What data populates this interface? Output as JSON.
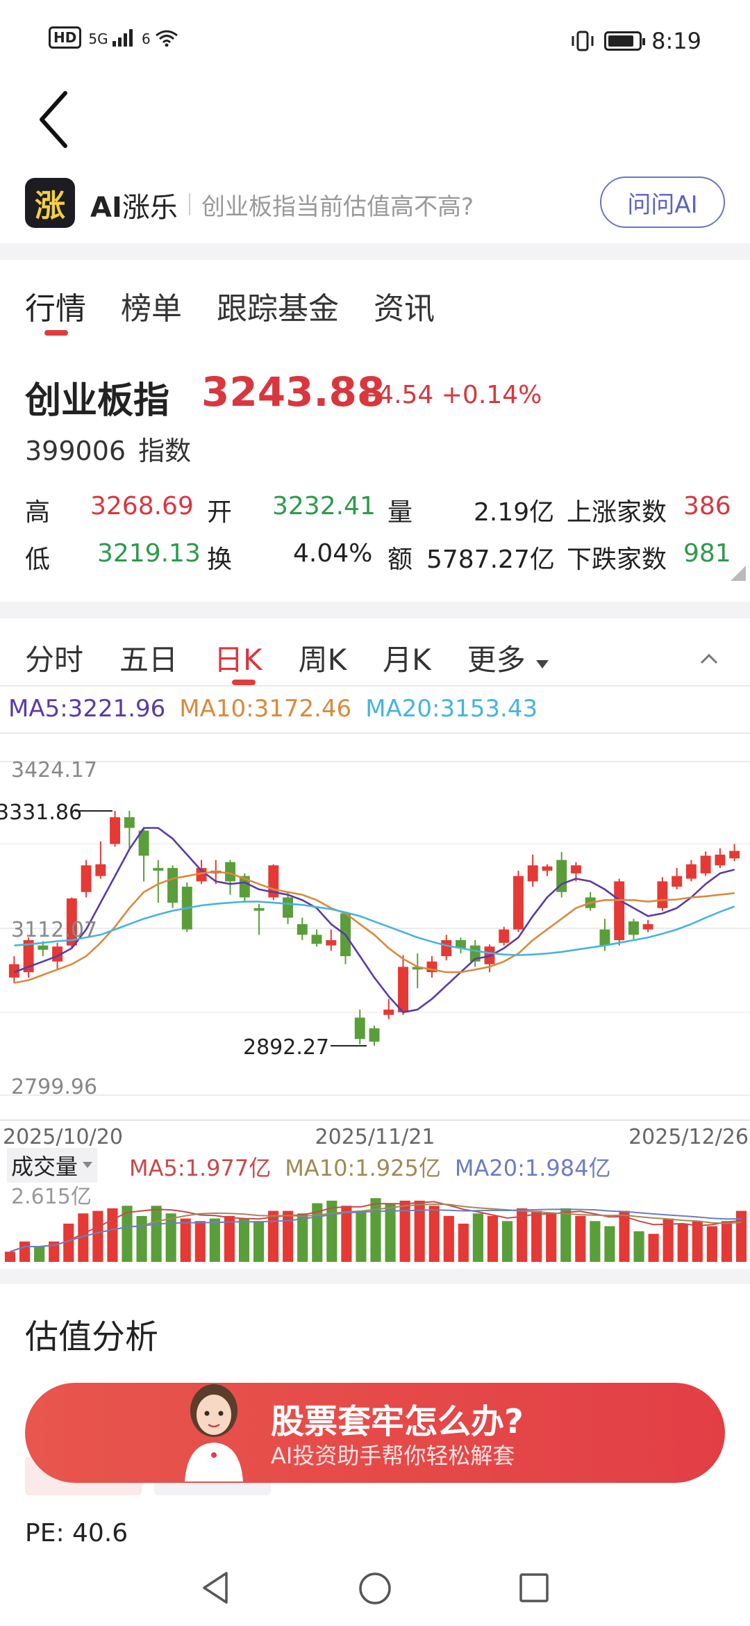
{
  "status_bar": {
    "hd": "HD",
    "signal": "5G",
    "wifi": "6",
    "time": "8:19"
  },
  "ai_bar": {
    "logo_char": "涨",
    "name_ai": "AI",
    "name_rest": "涨乐",
    "placeholder": "创业板指当前估值高不高?",
    "ask_button": "问问AI"
  },
  "main_tabs": [
    "行情",
    "榜单",
    "跟踪基金",
    "资讯"
  ],
  "index": {
    "name": "创业板指",
    "price": "3243.88",
    "change": "+4.54 +0.14%",
    "code": "399006",
    "type": "指数"
  },
  "stats": {
    "high_label": "高",
    "high": "3268.69",
    "open_label": "开",
    "open": "3232.41",
    "volume_label": "量",
    "volume": "2.19亿",
    "up_label": "上涨家数",
    "up": "386",
    "low_label": "低",
    "low": "3219.13",
    "turnover_label": "换",
    "turnover": "4.04%",
    "amount_label": "额",
    "amount": "5787.27亿",
    "down_label": "下跌家数",
    "down": "981"
  },
  "period_tabs": [
    "分时",
    "五日",
    "日K",
    "周K",
    "月K",
    "更多"
  ],
  "ma": {
    "ma5": "MA5:3221.96",
    "ma10": "MA10:3172.46",
    "ma20": "MA20:3153.43"
  },
  "chart_data": {
    "type": "candlestick",
    "y_ticks": [
      "3424.17",
      "3112.07",
      "2799.96"
    ],
    "ylim": [
      2799.96,
      3424.17
    ],
    "annotations": [
      {
        "label": "3331.86",
        "value": 3331.86
      },
      {
        "label": "2892.27",
        "value": 2892.27
      }
    ],
    "x_ticks": [
      "2025/10/20",
      "2025/11/21",
      "2025/12/26"
    ],
    "candles": [
      {
        "o": 3020,
        "c": 3045,
        "h": 3060,
        "l": 3010
      },
      {
        "o": 3030,
        "c": 3090,
        "h": 3095,
        "l": 3020
      },
      {
        "o": 3080,
        "c": 3072,
        "h": 3088,
        "l": 3060
      },
      {
        "o": 3050,
        "c": 3078,
        "h": 3085,
        "l": 3035
      },
      {
        "o": 3080,
        "c": 3168,
        "h": 3170,
        "l": 3075
      },
      {
        "o": 3180,
        "c": 3230,
        "h": 3240,
        "l": 3170
      },
      {
        "o": 3210,
        "c": 3232,
        "h": 3275,
        "l": 3205
      },
      {
        "o": 3270,
        "c": 3320,
        "h": 3332,
        "l": 3265
      },
      {
        "o": 3320,
        "c": 3300,
        "h": 3332,
        "l": 3260
      },
      {
        "o": 3295,
        "c": 3248,
        "h": 3300,
        "l": 3200
      },
      {
        "o": 3225,
        "c": 3220,
        "h": 3240,
        "l": 3160
      },
      {
        "o": 3225,
        "c": 3160,
        "h": 3230,
        "l": 3150
      },
      {
        "o": 3190,
        "c": 3110,
        "h": 3198,
        "l": 3105
      },
      {
        "o": 3200,
        "c": 3225,
        "h": 3240,
        "l": 3195
      },
      {
        "o": 3215,
        "c": 3220,
        "h": 3240,
        "l": 3195
      },
      {
        "o": 3236,
        "c": 3200,
        "h": 3240,
        "l": 3175
      },
      {
        "o": 3210,
        "c": 3170,
        "h": 3215,
        "l": 3160
      },
      {
        "o": 3150,
        "c": 3145,
        "h": 3158,
        "l": 3100
      },
      {
        "o": 3170,
        "c": 3230,
        "h": 3232,
        "l": 3165
      },
      {
        "o": 3170,
        "c": 3132,
        "h": 3180,
        "l": 3120
      },
      {
        "o": 3120,
        "c": 3100,
        "h": 3132,
        "l": 3090
      },
      {
        "o": 3100,
        "c": 3083,
        "h": 3110,
        "l": 3078
      },
      {
        "o": 3080,
        "c": 3090,
        "h": 3110,
        "l": 3070
      },
      {
        "o": 3140,
        "c": 3060,
        "h": 3142,
        "l": 3045
      },
      {
        "o": 2945,
        "c": 2905,
        "h": 2960,
        "l": 2895
      },
      {
        "o": 2925,
        "c": 2900,
        "h": 2930,
        "l": 2892
      },
      {
        "o": 2950,
        "c": 2960,
        "h": 2980,
        "l": 2942
      },
      {
        "o": 2955,
        "c": 3040,
        "h": 3062,
        "l": 2950
      },
      {
        "o": 3040,
        "c": 3035,
        "h": 3065,
        "l": 3000
      },
      {
        "o": 3030,
        "c": 3050,
        "h": 3060,
        "l": 3020
      },
      {
        "o": 3060,
        "c": 3090,
        "h": 3100,
        "l": 3052
      },
      {
        "o": 3090,
        "c": 3075,
        "h": 3095,
        "l": 3065
      },
      {
        "o": 3080,
        "c": 3050,
        "h": 3090,
        "l": 3040
      },
      {
        "o": 3045,
        "c": 3078,
        "h": 3082,
        "l": 3030
      },
      {
        "o": 3085,
        "c": 3110,
        "h": 3115,
        "l": 3080
      },
      {
        "o": 3110,
        "c": 3210,
        "h": 3220,
        "l": 3105
      },
      {
        "o": 3200,
        "c": 3230,
        "h": 3250,
        "l": 3190
      },
      {
        "o": 3220,
        "c": 3228,
        "h": 3232,
        "l": 3210
      },
      {
        "o": 3240,
        "c": 3180,
        "h": 3255,
        "l": 3170
      },
      {
        "o": 3215,
        "c": 3230,
        "h": 3236,
        "l": 3200
      },
      {
        "o": 3170,
        "c": 3150,
        "h": 3180,
        "l": 3145
      },
      {
        "o": 3110,
        "c": 3080,
        "h": 3130,
        "l": 3070
      },
      {
        "o": 3090,
        "c": 3200,
        "h": 3205,
        "l": 3080
      },
      {
        "o": 3125,
        "c": 3100,
        "h": 3130,
        "l": 3092
      },
      {
        "o": 3110,
        "c": 3120,
        "h": 3128,
        "l": 3105
      },
      {
        "o": 3150,
        "c": 3200,
        "h": 3208,
        "l": 3145
      },
      {
        "o": 3190,
        "c": 3210,
        "h": 3225,
        "l": 3185
      },
      {
        "o": 3205,
        "c": 3232,
        "h": 3240,
        "l": 3200
      },
      {
        "o": 3215,
        "c": 3248,
        "h": 3256,
        "l": 3210
      },
      {
        "o": 3230,
        "c": 3250,
        "h": 3262,
        "l": 3225
      },
      {
        "o": 3243,
        "c": 3257,
        "h": 3270,
        "l": 3238
      }
    ],
    "ma_lines": [
      {
        "name": "MA5",
        "color": "#5a3aa8",
        "values": [
          3030,
          3040,
          3050,
          3060,
          3075,
          3110,
          3160,
          3210,
          3260,
          3300,
          3300,
          3280,
          3250,
          3220,
          3200,
          3195,
          3198,
          3185,
          3180,
          3175,
          3165,
          3150,
          3120,
          3100,
          3060,
          3020,
          2985,
          2955,
          2960,
          2980,
          3005,
          3030,
          3055,
          3060,
          3075,
          3095,
          3135,
          3170,
          3195,
          3205,
          3200,
          3185,
          3165,
          3150,
          3135,
          3140,
          3150,
          3170,
          3195,
          3215,
          3222
        ]
      },
      {
        "name": "MA10",
        "color": "#d98a3c",
        "values": [
          3010,
          3015,
          3025,
          3035,
          3045,
          3060,
          3085,
          3115,
          3150,
          3180,
          3195,
          3205,
          3210,
          3215,
          3218,
          3215,
          3205,
          3195,
          3185,
          3180,
          3175,
          3165,
          3150,
          3140,
          3120,
          3100,
          3075,
          3055,
          3040,
          3035,
          3030,
          3030,
          3035,
          3040,
          3050,
          3065,
          3090,
          3110,
          3130,
          3150,
          3160,
          3165,
          3165,
          3165,
          3162,
          3165,
          3166,
          3170,
          3172,
          3175,
          3178
        ]
      },
      {
        "name": "MA20",
        "color": "#46b4dc",
        "values": [
          3080,
          3082,
          3085,
          3088,
          3090,
          3095,
          3100,
          3110,
          3120,
          3130,
          3138,
          3145,
          3150,
          3155,
          3158,
          3160,
          3162,
          3162,
          3160,
          3158,
          3156,
          3152,
          3148,
          3142,
          3135,
          3125,
          3115,
          3105,
          3095,
          3087,
          3080,
          3075,
          3070,
          3066,
          3063,
          3062,
          3063,
          3065,
          3068,
          3072,
          3076,
          3080,
          3085,
          3090,
          3095,
          3102,
          3110,
          3120,
          3132,
          3143,
          3153
        ]
      }
    ]
  },
  "volume": {
    "label": "成交量",
    "ma5": "MA5:1.977亿",
    "ma10": "MA10:1.925亿",
    "ma20": "MA20:1.984亿",
    "max_label": "2.615亿",
    "bars": [
      {
        "v": 0.4,
        "up": true
      },
      {
        "v": 0.8,
        "up": true
      },
      {
        "v": 0.6,
        "up": false
      },
      {
        "v": 0.8,
        "up": true
      },
      {
        "v": 1.5,
        "up": true
      },
      {
        "v": 1.9,
        "up": true
      },
      {
        "v": 2.0,
        "up": true
      },
      {
        "v": 2.1,
        "up": true
      },
      {
        "v": 2.2,
        "up": false
      },
      {
        "v": 1.8,
        "up": false
      },
      {
        "v": 2.2,
        "up": false
      },
      {
        "v": 1.9,
        "up": false
      },
      {
        "v": 1.7,
        "up": true
      },
      {
        "v": 1.6,
        "up": true
      },
      {
        "v": 1.7,
        "up": false
      },
      {
        "v": 1.8,
        "up": true
      },
      {
        "v": 1.7,
        "up": false
      },
      {
        "v": 1.6,
        "up": false
      },
      {
        "v": 2.0,
        "up": true
      },
      {
        "v": 2.0,
        "up": true
      },
      {
        "v": 1.9,
        "up": false
      },
      {
        "v": 2.3,
        "up": false
      },
      {
        "v": 2.4,
        "up": false
      },
      {
        "v": 2.2,
        "up": true
      },
      {
        "v": 2.0,
        "up": false
      },
      {
        "v": 2.5,
        "up": false
      },
      {
        "v": 2.3,
        "up": false
      },
      {
        "v": 2.4,
        "up": true
      },
      {
        "v": 2.4,
        "up": true
      },
      {
        "v": 2.2,
        "up": true
      },
      {
        "v": 1.8,
        "up": true
      },
      {
        "v": 1.5,
        "up": true
      },
      {
        "v": 1.9,
        "up": false
      },
      {
        "v": 1.8,
        "up": true
      },
      {
        "v": 1.6,
        "up": false
      },
      {
        "v": 2.1,
        "up": true
      },
      {
        "v": 2.0,
        "up": true
      },
      {
        "v": 1.9,
        "up": true
      },
      {
        "v": 2.1,
        "up": false
      },
      {
        "v": 1.8,
        "up": true
      },
      {
        "v": 1.6,
        "up": false
      },
      {
        "v": 1.4,
        "up": false
      },
      {
        "v": 2.0,
        "up": true
      },
      {
        "v": 1.2,
        "up": false
      },
      {
        "v": 1.1,
        "up": true
      },
      {
        "v": 1.7,
        "up": true
      },
      {
        "v": 1.5,
        "up": true
      },
      {
        "v": 1.6,
        "up": true
      },
      {
        "v": 1.4,
        "up": true
      },
      {
        "v": 1.6,
        "up": true
      },
      {
        "v": 2.0,
        "up": true
      }
    ]
  },
  "valuation": {
    "title": "估值分析",
    "pe": "PE: 40.6"
  },
  "banner": {
    "title": "股票套牢怎么办?",
    "subtitle": "AI投资助手帮你轻松解套"
  },
  "colors": {
    "up": "#e53935",
    "down": "#5a9e3a",
    "accent": "#d9363e"
  }
}
